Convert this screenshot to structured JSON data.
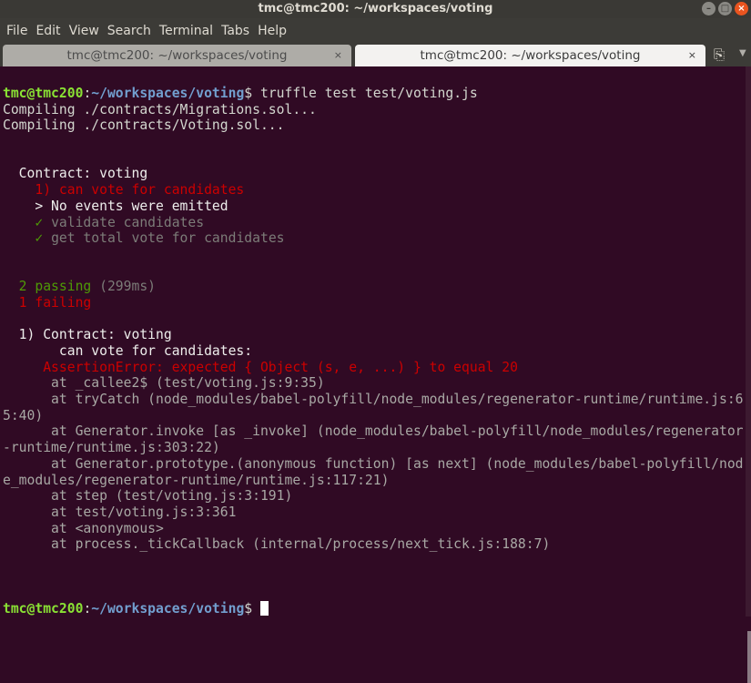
{
  "window": {
    "title": "tmc@tmc200: ~/workspaces/voting",
    "minimize": "–",
    "maximize": "□",
    "close": "×"
  },
  "menu": [
    "File",
    "Edit",
    "View",
    "Search",
    "Terminal",
    "Tabs",
    "Help"
  ],
  "tabs": [
    {
      "label": "tmc@tmc200: ~/workspaces/voting",
      "close": "×",
      "active": false
    },
    {
      "label": "tmc@tmc200: ~/workspaces/voting",
      "close": "×",
      "active": true
    }
  ],
  "new_tab_icon": "⎘",
  "tab_menu_icon": "▼",
  "colors": {
    "background": "#300a24",
    "prompt_user": "#8ae234",
    "prompt_path": "#729fcf",
    "error": "#cc0000",
    "pass": "#4e9a06"
  },
  "terminal": {
    "lines": [
      [
        [
          "green",
          "tmc@tmc200"
        ],
        [
          "def",
          ":"
        ],
        [
          "blue",
          "~/workspaces/voting"
        ],
        [
          "def",
          "$ truffle test test/voting.js"
        ]
      ],
      [
        [
          "def",
          "Compiling ./contracts/Migrations.sol..."
        ]
      ],
      [
        [
          "def",
          "Compiling ./contracts/Voting.sol..."
        ]
      ],
      [],
      [],
      [
        [
          "white",
          "  Contract: voting"
        ]
      ],
      [
        [
          "red",
          "    1) can vote for candidates"
        ]
      ],
      [
        [
          "white",
          "    > No events were emitted"
        ]
      ],
      [
        [
          "check",
          "    ✓ "
        ],
        [
          "gray",
          "validate candidates"
        ]
      ],
      [
        [
          "check",
          "    ✓ "
        ],
        [
          "gray",
          "get total vote for candidates"
        ]
      ],
      [],
      [],
      [
        [
          "pass",
          "  2 passing "
        ],
        [
          "gray",
          "(299ms)"
        ]
      ],
      [
        [
          "red",
          "  1 failing"
        ]
      ],
      [],
      [
        [
          "white",
          "  1) Contract: voting"
        ]
      ],
      [
        [
          "white",
          "       can vote for candidates:"
        ]
      ],
      [
        [
          "red",
          "     AssertionError: expected { Object (s, e, ...) } to equal 20"
        ]
      ],
      [
        [
          "trace",
          "      at _callee2$ (test/voting.js:9:35)"
        ]
      ],
      [
        [
          "trace",
          "      at tryCatch (node_modules/babel-polyfill/node_modules/regenerator-runtime/runtime.js:6"
        ]
      ],
      [
        [
          "trace",
          "5:40)"
        ]
      ],
      [
        [
          "trace",
          "      at Generator.invoke [as _invoke] (node_modules/babel-polyfill/node_modules/regenerator"
        ]
      ],
      [
        [
          "trace",
          "-runtime/runtime.js:303:22)"
        ]
      ],
      [
        [
          "trace",
          "      at Generator.prototype.(anonymous function) [as next] (node_modules/babel-polyfill/nod"
        ]
      ],
      [
        [
          "trace",
          "e_modules/regenerator-runtime/runtime.js:117:21)"
        ]
      ],
      [
        [
          "trace",
          "      at step (test/voting.js:3:191)"
        ]
      ],
      [
        [
          "trace",
          "      at test/voting.js:3:361"
        ]
      ],
      [
        [
          "trace",
          "      at <anonymous>"
        ]
      ],
      [
        [
          "trace",
          "      at process._tickCallback (internal/process/next_tick.js:188:7)"
        ]
      ],
      [],
      [],
      [],
      [
        [
          "green",
          "tmc@tmc200"
        ],
        [
          "def",
          ":"
        ],
        [
          "blue",
          "~/workspaces/voting"
        ],
        [
          "def",
          "$ "
        ]
      ]
    ]
  }
}
